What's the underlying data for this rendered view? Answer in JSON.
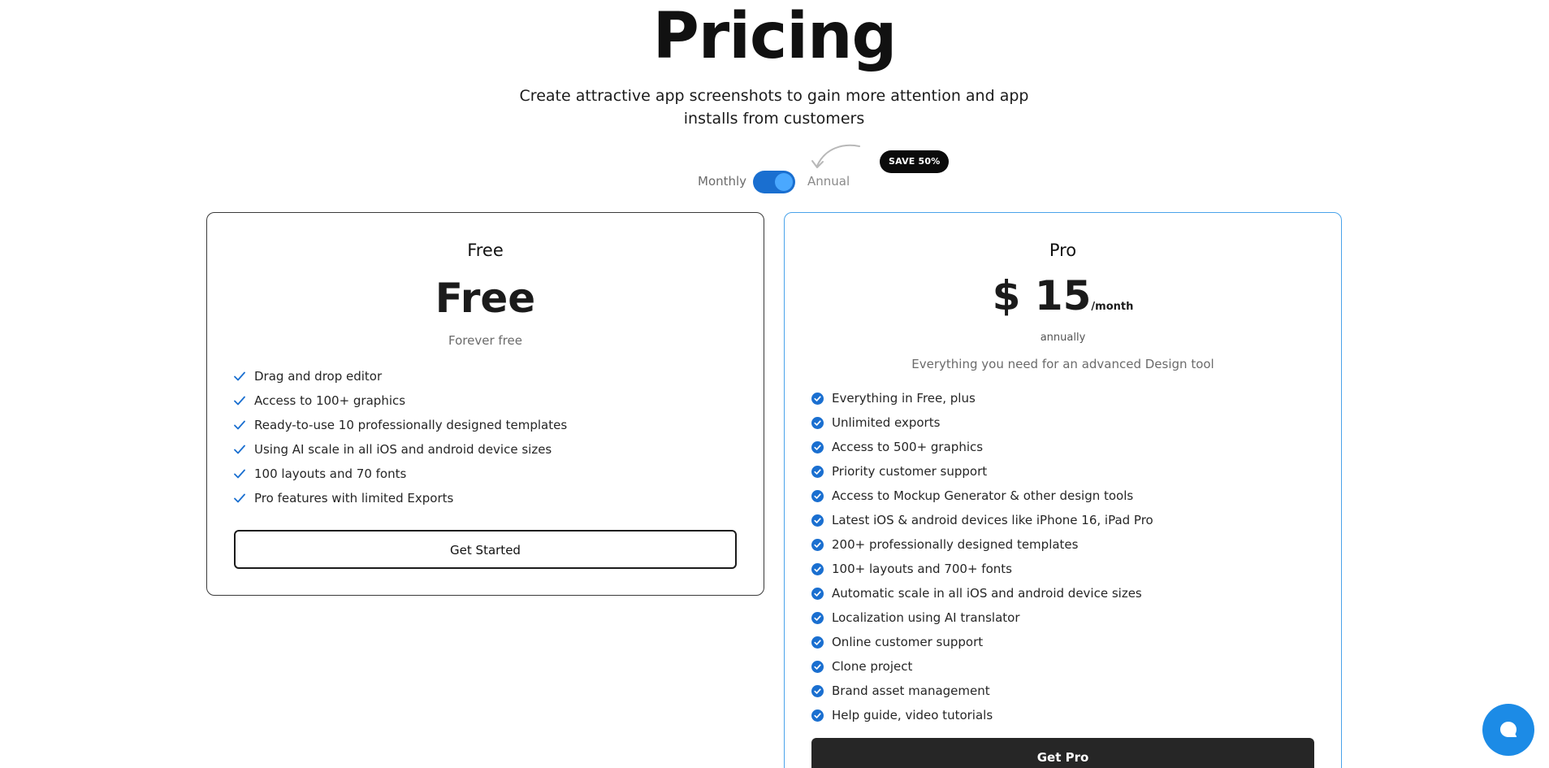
{
  "header": {
    "title": "Pricing",
    "subtitle": "Create attractive app screenshots to gain more attention and app installs from customers"
  },
  "billing": {
    "monthly_label": "Monthly",
    "annual_label": "Annual",
    "toggle_on": true,
    "save_badge": "SAVE 50%"
  },
  "plans": {
    "free": {
      "name": "Free",
      "price": "Free",
      "note": "Forever free",
      "features": [
        "Drag and drop editor",
        "Access to 100+ graphics",
        "Ready-to-use 10 professionally designed templates",
        "Using AI scale in all iOS and android device sizes",
        "100 layouts and 70 fonts",
        "Pro features with limited Exports"
      ],
      "cta": "Get Started"
    },
    "pro": {
      "name": "Pro",
      "price": "$ 15",
      "period": "/month",
      "billing_note": "annually",
      "description": "Everything you need for an advanced Design tool",
      "features": [
        "Everything in Free, plus",
        "Unlimited exports",
        "Access to 500+ graphics",
        "Priority customer support",
        "Access to Mockup Generator & other design tools",
        "Latest iOS & android devices like iPhone 16, iPad Pro",
        "200+ professionally designed templates",
        "100+ layouts and 700+ fonts",
        "Automatic scale in all iOS and android device sizes",
        "Localization using AI translator",
        "Online customer support",
        "Clone project",
        "Brand asset management",
        "Help guide, video tutorials"
      ],
      "cta": "Get Pro"
    }
  },
  "chat": {
    "icon": "chat-bubble-icon"
  },
  "colors": {
    "accent": "#1a6fd0",
    "pro_border": "#4aa3ea",
    "check_blue": "#1a6fd0",
    "dark_button": "#262626",
    "chat_button": "#1c8be6"
  }
}
